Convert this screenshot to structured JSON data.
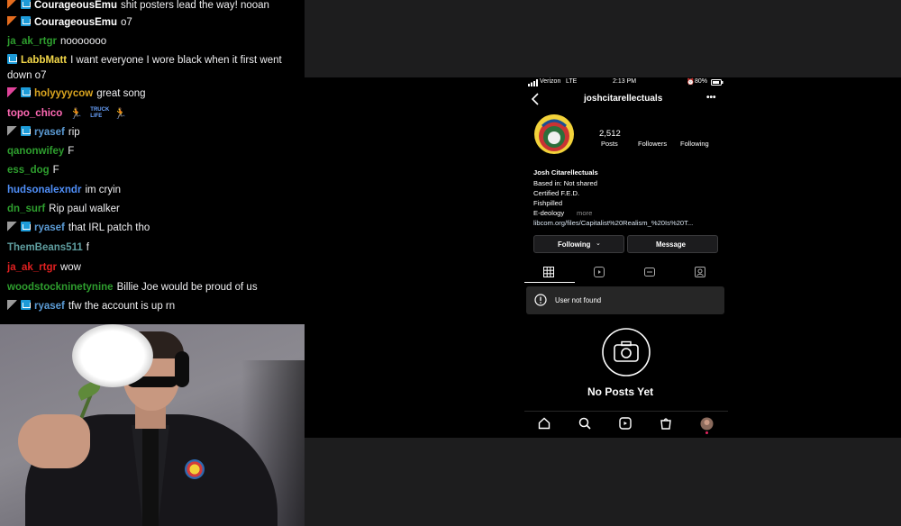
{
  "chat": {
    "messages": [
      {
        "badges": [
          "sub",
          "prime"
        ],
        "user": "CourageousEmu",
        "color": "#ffffff",
        "text": "shit posters lead the way! nooan"
      },
      {
        "badges": [
          "sub",
          "prime"
        ],
        "user": "CourageousEmu",
        "color": "#ffffff",
        "text": "o7"
      },
      {
        "badges": [],
        "user": "ja_ak_rtgr",
        "color": "#2e9e2e",
        "text": "nooooooo"
      },
      {
        "badges": [
          "prime"
        ],
        "user": "LabbMatt",
        "color": "#f5d94a",
        "text": "I want everyone I wore black when it first went down o7"
      },
      {
        "badges": [
          "vip",
          "prime"
        ],
        "user": "holyyyycow",
        "color": "#daa520",
        "text": "great song"
      },
      {
        "badges": [],
        "user": "topo_chico",
        "color": "#ff69b4",
        "text": ""
      },
      {
        "badges": [
          "mod",
          "prime"
        ],
        "user": "ryasef",
        "color": "#5b9bd5",
        "text": "rip"
      },
      {
        "badges": [],
        "user": "qanonwifey",
        "color": "#2e9e2e",
        "text": "F"
      },
      {
        "badges": [],
        "user": "ess_dog",
        "color": "#2e9e2e",
        "text": "F"
      },
      {
        "badges": [],
        "user": "hudsonalexndr",
        "color": "#4f8ef7",
        "text": "im cryin"
      },
      {
        "badges": [],
        "user": "dn_surf",
        "color": "#2e9e2e",
        "text": "Rip paul walker"
      },
      {
        "badges": [
          "mod",
          "prime"
        ],
        "user": "ryasef",
        "color": "#5b9bd5",
        "text": "that IRL patch tho"
      },
      {
        "badges": [],
        "user": "ThemBeans511",
        "color": "#5f9ea0",
        "text": "f"
      },
      {
        "badges": [],
        "user": "ja_ak_rtgr",
        "color": "#e02020",
        "text": "wow"
      },
      {
        "badges": [],
        "user": "woodstockninetynine",
        "color": "#2e9e2e",
        "text": "Billie Joe would be proud of us"
      },
      {
        "badges": [
          "mod",
          "prime"
        ],
        "user": "ryasef",
        "color": "#5b9bd5",
        "text": "tfw the account is up rn"
      }
    ],
    "topo_emotes": [
      "🏃",
      "TRUCK LIFE",
      "🏃"
    ]
  },
  "phone": {
    "carrier": "Verizon",
    "network": "LTE",
    "time": "2:13 PM",
    "battery": "80%",
    "username": "joshcitarellectuals",
    "stats": {
      "posts_count": "2,512",
      "posts_label": "Posts",
      "followers_label": "Followers",
      "following_label": "Following"
    },
    "bio": {
      "name": "Josh Citarellectuals",
      "lines": [
        "Based in: Not shared",
        "Certified F.E.D.",
        "Fishpilled",
        "E-deology"
      ],
      "more": "more",
      "link": "libcom.org/files/Capitalist%20Realism_%20Is%20T..."
    },
    "following_button": "Following",
    "message_button": "Message",
    "toast": "User not found",
    "empty_title": "No Posts Yet"
  },
  "colors": {
    "ig_button": "#1c1c1e",
    "toast_bg": "#262626",
    "screen_border": "#1d1d1e"
  }
}
